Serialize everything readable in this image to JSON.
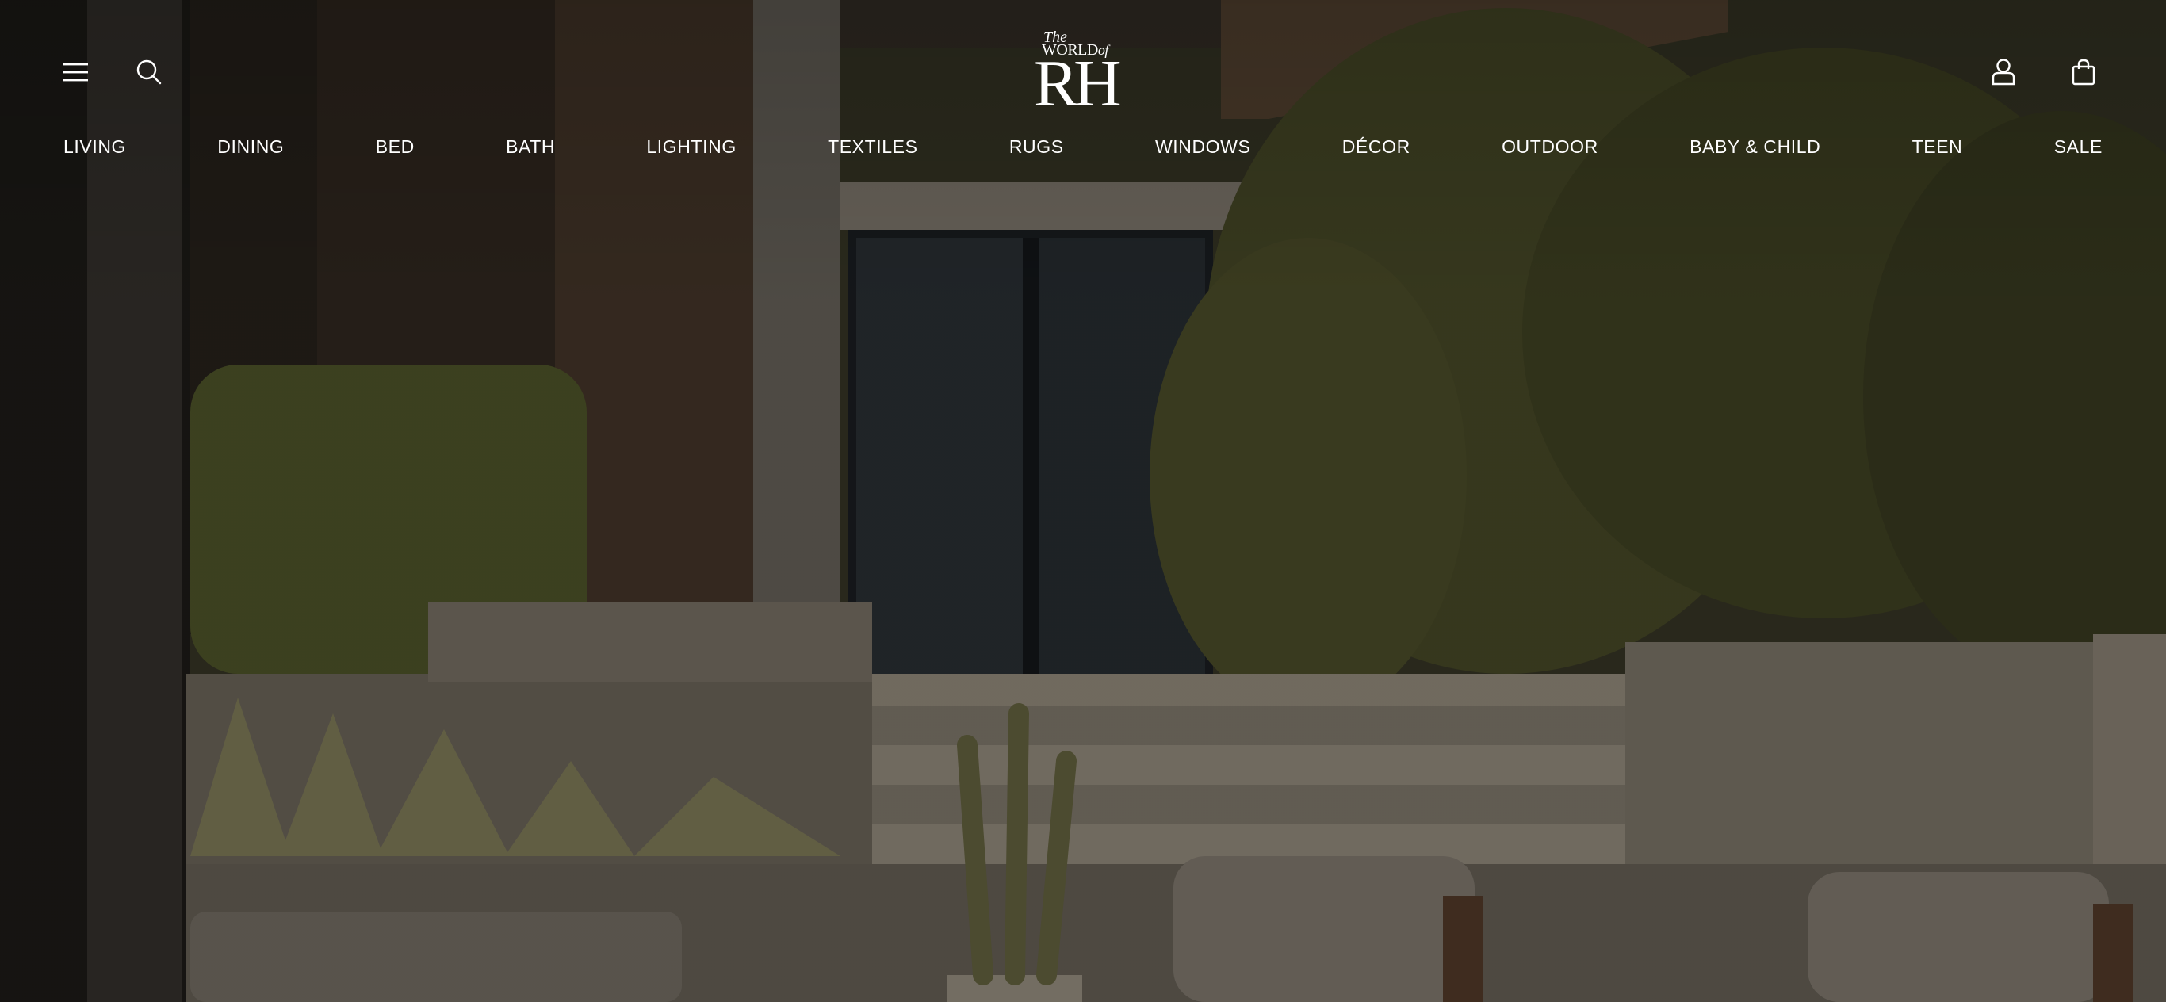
{
  "header": {
    "logo": {
      "line1": "The",
      "line2": "WORLD",
      "line2b": "of",
      "mark": "RH"
    },
    "icons": {
      "menu": "hamburger-menu-icon",
      "search": "search-icon",
      "account": "user-icon",
      "cart": "shopping-bag-icon"
    }
  },
  "nav": {
    "items": [
      {
        "label": "LIVING"
      },
      {
        "label": "DINING"
      },
      {
        "label": "BED"
      },
      {
        "label": "BATH"
      },
      {
        "label": "LIGHTING"
      },
      {
        "label": "TEXTILES"
      },
      {
        "label": "RUGS"
      },
      {
        "label": "WINDOWS"
      },
      {
        "label": "DÉCOR"
      },
      {
        "label": "OUTDOOR"
      },
      {
        "label": "BABY & CHILD"
      },
      {
        "label": "TEEN"
      },
      {
        "label": "SALE"
      }
    ]
  },
  "colors": {
    "text": "#ffffff",
    "overlay": "#000000"
  }
}
